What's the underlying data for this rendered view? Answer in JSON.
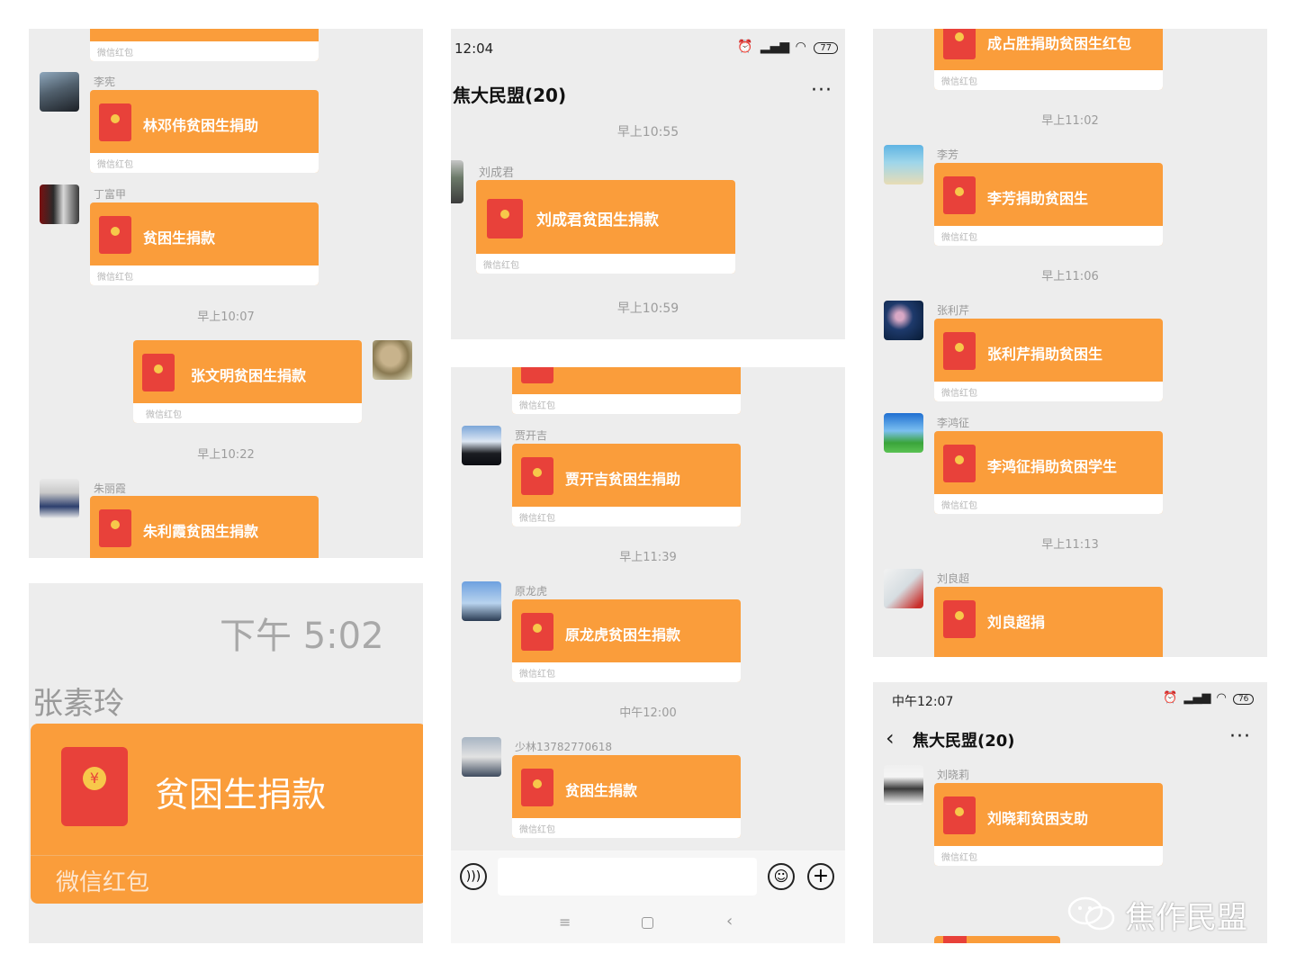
{
  "panel_a": {
    "rp_top_label": "微信红包",
    "msg1": {
      "sender": "李宪",
      "title": "林邓伟贫困生捐助",
      "label": "微信红包"
    },
    "msg2": {
      "sender": "丁富甲",
      "title": "贫困生捐款",
      "label": "微信红包"
    },
    "time1": "早上10:07",
    "msg3": {
      "title": "张文明贫困生捐款",
      "label": "微信红包"
    },
    "time2": "早上10:22",
    "msg4": {
      "sender": "朱丽霞",
      "title": "朱利霞贫困生捐款"
    }
  },
  "panel_b": {
    "time": "下午 5:02",
    "sender": "张素玲",
    "title": "贫困生捐款",
    "label": "微信红包"
  },
  "panel_c": {
    "status_time": "12:04",
    "battery": "77",
    "chat_title": "焦大民盟(20)",
    "more": "···",
    "time1": "早上10:55",
    "msg1": {
      "sender": "刘成君",
      "title": "刘成君贫困生捐款",
      "label": "微信红包"
    },
    "time2": "早上10:59"
  },
  "panel_d": {
    "rp_top_label": "微信红包",
    "msg1": {
      "sender": "贾开吉",
      "title": "贾开吉贫困生捐助",
      "label": "微信红包"
    },
    "time1": "早上11:39",
    "msg2": {
      "sender": "原龙虎",
      "title": "原龙虎贫困生捐款",
      "label": "微信红包"
    },
    "time2": "中午12:00",
    "msg3": {
      "sender": "少林13782770618",
      "title": "贫困生捐款",
      "label": "微信红包"
    },
    "icons": {
      "voice": "voice-icon",
      "emoji": "emoji-icon",
      "plus": "plus-icon",
      "menu": "menu-icon",
      "home": "home-icon",
      "back": "back-icon"
    }
  },
  "panel_e": {
    "msg0": {
      "title": "成占胜捐助贫困生红包",
      "label": "微信红包"
    },
    "time1": "早上11:02",
    "msg1": {
      "sender": "李芳",
      "title": "李芳捐助贫困生",
      "label": "微信红包"
    },
    "time2": "早上11:06",
    "msg2": {
      "sender": "张利芹",
      "title": "张利芹捐助贫困生",
      "label": "微信红包"
    },
    "msg3": {
      "sender": "李鸿征",
      "title": "李鸿征捐助贫困学生",
      "label": "微信红包"
    },
    "time3": "早上11:13",
    "msg4": {
      "sender": "刘良超",
      "title": "刘良超捐"
    }
  },
  "panel_f": {
    "status_time": "中午12:07",
    "battery": "76",
    "chat_title": "焦大民盟(20)",
    "more": "···",
    "msg1": {
      "sender": "刘晓莉",
      "title": "刘晓莉贫困支助",
      "label": "微信红包"
    },
    "watermark": "焦作民盟"
  },
  "colors": {
    "packet": "#fa9d3b",
    "envelope": "#e8413a",
    "bg": "#ededed"
  }
}
